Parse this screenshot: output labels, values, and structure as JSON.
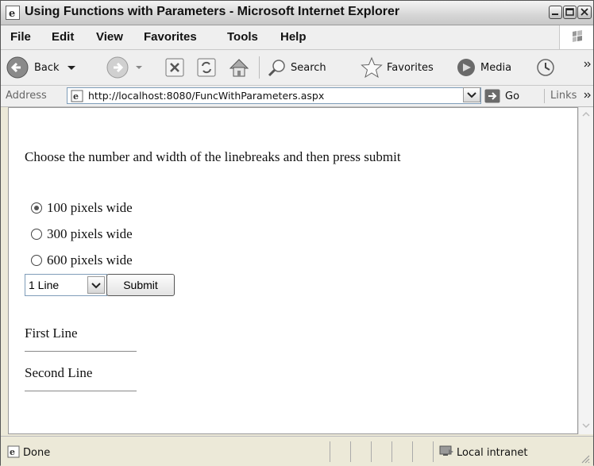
{
  "window": {
    "title": "Using Functions with Parameters - Microsoft Internet Explorer"
  },
  "menu": {
    "items": [
      {
        "label": "File"
      },
      {
        "label": "Edit"
      },
      {
        "label": "View"
      },
      {
        "label": "Favorites"
      },
      {
        "label": "Tools"
      },
      {
        "label": "Help"
      }
    ]
  },
  "toolbar": {
    "back_label": "Back",
    "search_label": "Search",
    "favorites_label": "Favorites",
    "media_label": "Media"
  },
  "addressbar": {
    "label": "Address",
    "url": "http://localhost:8080/FuncWithParameters.aspx",
    "go_label": "Go",
    "links_label": "Links"
  },
  "page": {
    "instruction": "Choose the number and width of the linebreaks and then press submit",
    "width_options": [
      {
        "label": "100 pixels wide",
        "checked": true
      },
      {
        "label": "300 pixels wide",
        "checked": false
      },
      {
        "label": "600 pixels wide",
        "checked": false
      }
    ],
    "line_select": {
      "selected": "1 Line"
    },
    "submit_label": "Submit",
    "lines": [
      "First Line",
      "Second Line"
    ]
  },
  "statusbar": {
    "status": "Done",
    "zone": "Local intranet"
  },
  "colors": {
    "title_bar": "#d6d6d6",
    "content_bg": "#ffffff",
    "chrome": "#efefef"
  }
}
